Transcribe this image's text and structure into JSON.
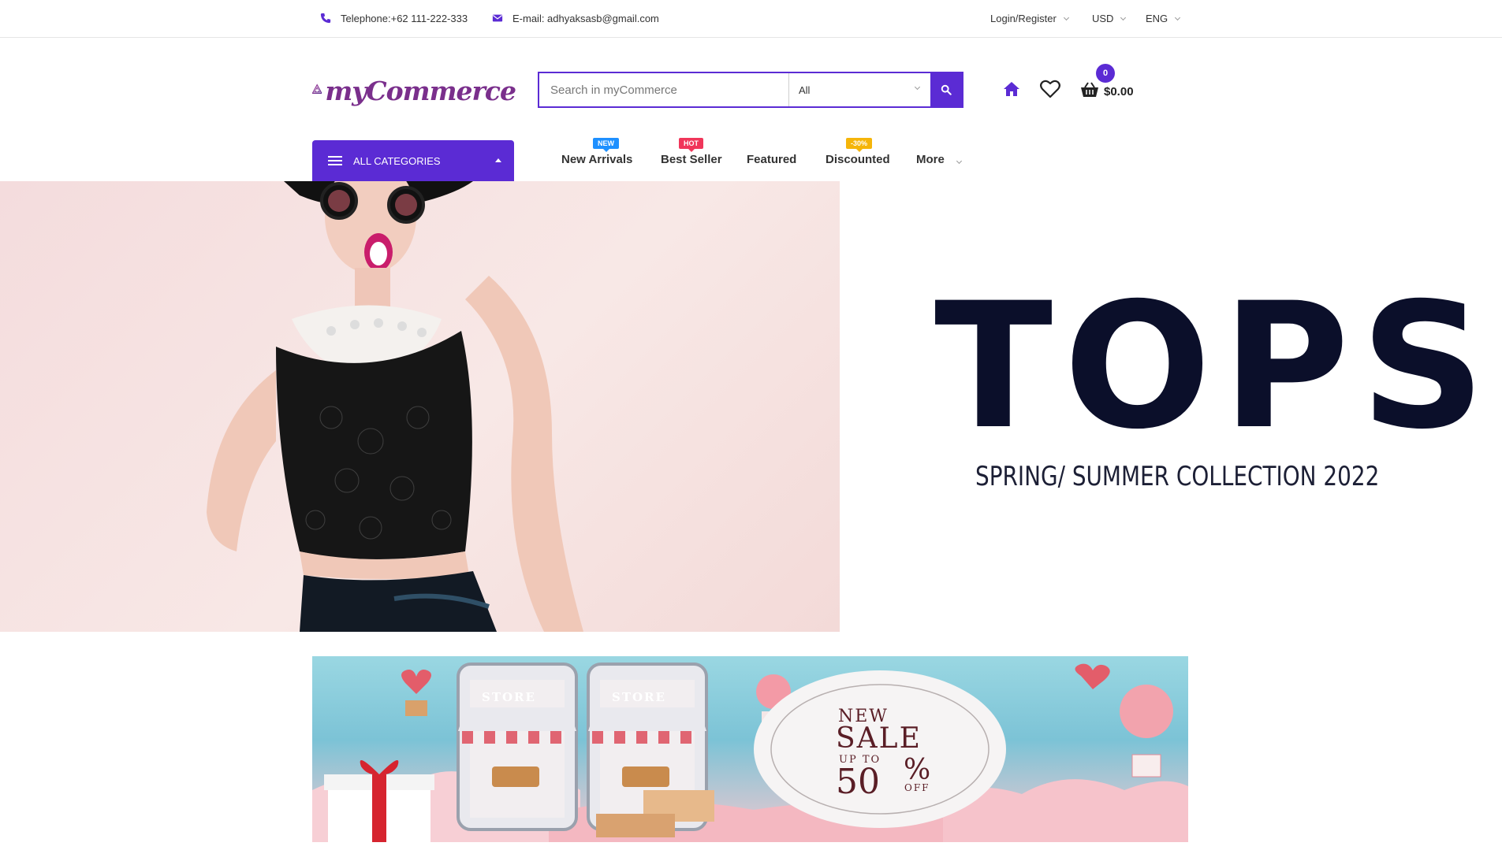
{
  "topbar": {
    "phone": "Telephone:+62 111-222-333",
    "email": "E-mail: adhyaksasb@gmail.com",
    "account": "Login/Register",
    "currency": "USD",
    "language": "ENG"
  },
  "header": {
    "logo_text": "myCommerce",
    "search_placeholder": "Search in myCommerce",
    "category_selected": "All",
    "cart_count": "0",
    "cart_total": "$0.00"
  },
  "nav": {
    "all_categories": "ALL CATEGORIES",
    "items": [
      {
        "label": "New Arrivals",
        "badge": "NEW",
        "badge_color": "#1e90ff"
      },
      {
        "label": "Best Seller",
        "badge": "HOT",
        "badge_color": "#f0365a"
      },
      {
        "label": "Featured"
      },
      {
        "label": "Discounted",
        "badge": "-30%",
        "badge_color": "#f5b50a"
      },
      {
        "label": "More"
      }
    ]
  },
  "hero": {
    "title": "TOPS",
    "subtitle": "SPRING/ SUMMER COLLECTION 2022"
  },
  "promo": {
    "store_label_1": "STORE",
    "store_label_2": "STORE",
    "line1": "NEW",
    "line2": "SALE",
    "line3": "UP TO",
    "amount": "50",
    "percent": "%",
    "off": "OFF"
  },
  "colors": {
    "accent": "#5b2bd4",
    "logo": "#7a2f8c",
    "hero_text": "#0b0f2a"
  }
}
